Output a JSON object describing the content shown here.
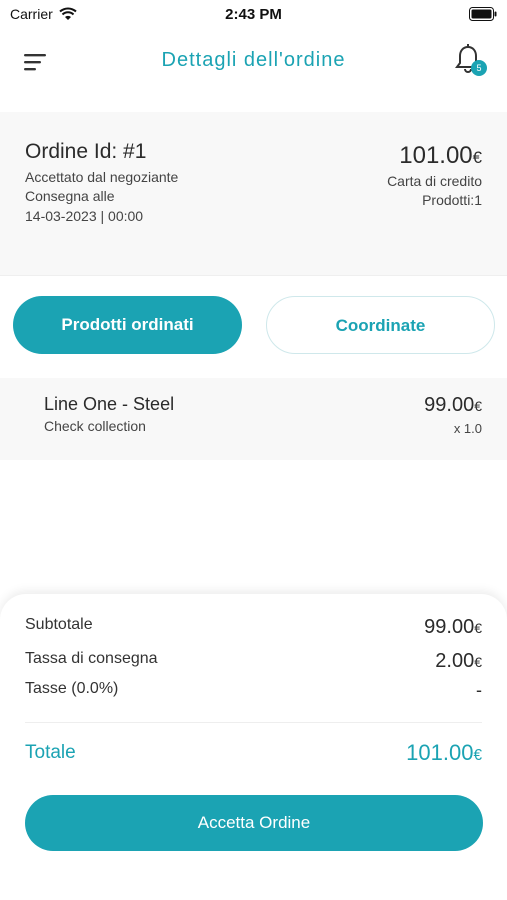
{
  "status_bar": {
    "carrier": "Carrier",
    "time": "2:43 PM"
  },
  "header": {
    "title": "Dettagli dell'ordine",
    "notifications_count": "5"
  },
  "order": {
    "id_label": "Ordine Id: #1",
    "status": "Accettato dal negoziante",
    "delivery_label": "Consegna alle",
    "delivery_date": "14-03-2023 | 00:00",
    "total_amount": "101.00",
    "currency": "€",
    "payment_method": "Carta di credito",
    "products_count": "Prodotti:1"
  },
  "tabs": [
    {
      "label": "Prodotti ordinati",
      "active": true
    },
    {
      "label": "Coordinate",
      "active": false
    }
  ],
  "products": [
    {
      "name": "Line One - Steel",
      "subtitle": "Check collection",
      "price": "99.00",
      "currency": "€",
      "quantity": "x 1.0"
    }
  ],
  "summary": {
    "subtotal_label": "Subtotale",
    "subtotal_value": "99.00",
    "delivery_fee_label": "Tassa di consegna",
    "delivery_fee_value": "2.00",
    "tax_label": "Tasse (0.0%)",
    "tax_value": "-",
    "total_label": "Totale",
    "total_value": "101.00",
    "currency": "€"
  },
  "actions": {
    "accept_label": "Accetta Ordine"
  },
  "colors": {
    "accent": "#1ba3b3",
    "card_background": "#f8f8f8"
  }
}
